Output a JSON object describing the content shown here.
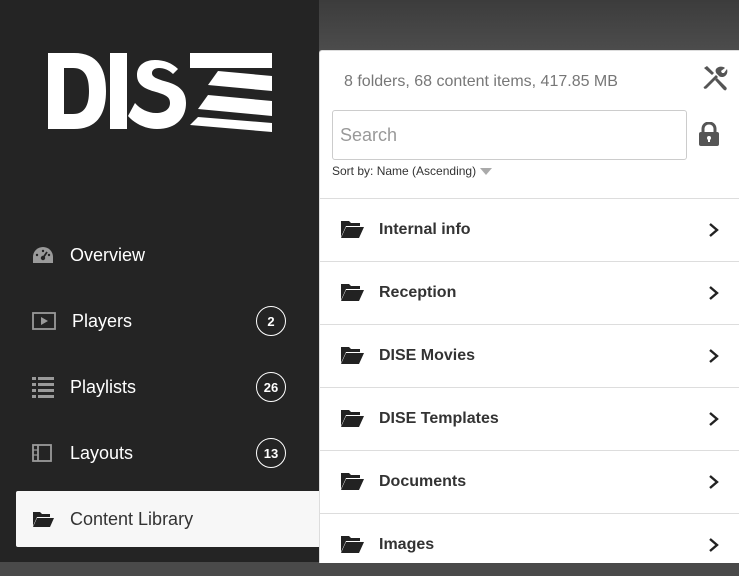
{
  "brand": {
    "logo_text": "DISE"
  },
  "nav": [
    {
      "label": "Overview",
      "badge": null,
      "icon": "dashboard-icon"
    },
    {
      "label": "Players",
      "badge": "2",
      "icon": "player-icon"
    },
    {
      "label": "Playlists",
      "badge": "26",
      "icon": "playlist-icon"
    },
    {
      "label": "Layouts",
      "badge": "13",
      "icon": "layout-icon"
    },
    {
      "label": "Content Library",
      "badge": null,
      "icon": "folder-open-icon",
      "active": true
    }
  ],
  "library": {
    "summary": "8 folders, 68 content items, 417.85 MB",
    "search_placeholder": "Search",
    "sort_prefix": "Sort by:",
    "sort_value": "Name (Ascending)",
    "folders": [
      {
        "name": "Internal info"
      },
      {
        "name": "Reception"
      },
      {
        "name": "DISE Movies"
      },
      {
        "name": "DISE Templates"
      },
      {
        "name": "Documents"
      },
      {
        "name": "Images"
      }
    ]
  },
  "colors": {
    "sidebar": "#242424",
    "active_bg": "#f7f7f7",
    "text_dark": "#333333",
    "muted": "#777777"
  }
}
